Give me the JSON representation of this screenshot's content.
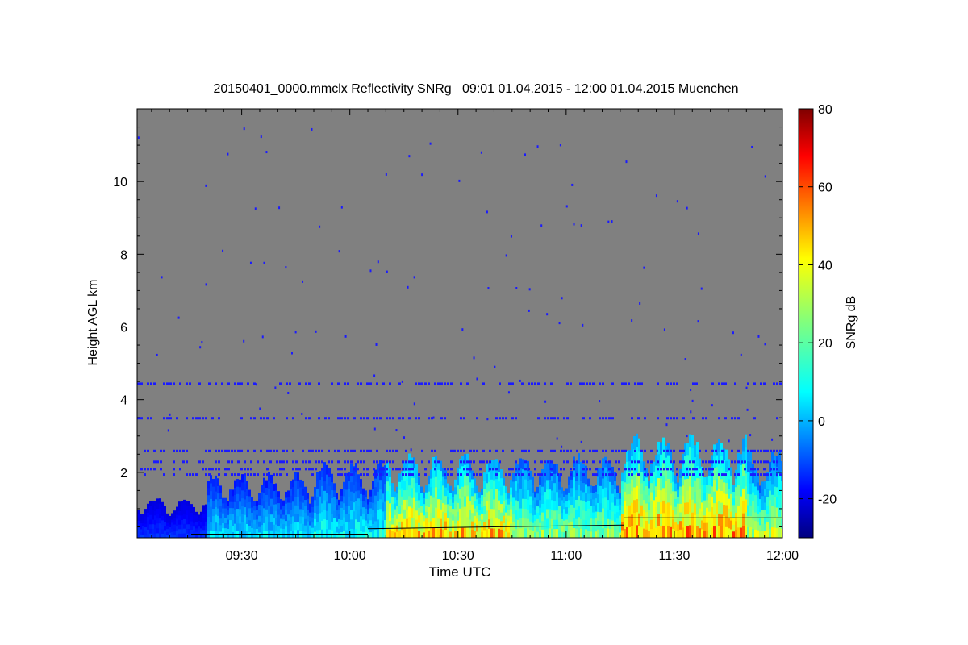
{
  "chart_data": {
    "type": "heatmap",
    "title": "20150401_0000.mmclx Reflectivity SNRg   09:01 01.04.2015 - 12:00 01.04.2015 Muenchen",
    "xlabel": "Time UTC",
    "ylabel": "Height AGL km",
    "x_ticks": [
      "09:30",
      "10:00",
      "10:30",
      "11:00",
      "11:30",
      "12:00"
    ],
    "x_range": [
      "09:01",
      "12:00"
    ],
    "y_ticks": [
      2,
      4,
      6,
      8,
      10
    ],
    "y_range": [
      0.2,
      12.0
    ],
    "background_color": "#808080",
    "colorbar": {
      "label": "SNRg dB",
      "range": [
        -30,
        80
      ],
      "ticks": [
        -20,
        0,
        20,
        40,
        60,
        80
      ],
      "colormap": "jet"
    },
    "clutter_layers_km": [
      4.45,
      3.5,
      2.6,
      2.3,
      2.1,
      1.95
    ],
    "echo_segments": [
      {
        "start": "09:01",
        "end": "09:20",
        "top_km": 1.2,
        "peak_snr_db": -10
      },
      {
        "start": "09:20",
        "end": "09:50",
        "top_km": 1.8,
        "peak_snr_db": 10
      },
      {
        "start": "09:50",
        "end": "10:10",
        "top_km": 2.1,
        "peak_snr_db": 15
      },
      {
        "start": "10:10",
        "end": "10:45",
        "top_km": 2.3,
        "peak_snr_db": 50
      },
      {
        "start": "10:45",
        "end": "11:15",
        "top_km": 2.3,
        "peak_snr_db": 30
      },
      {
        "start": "11:15",
        "end": "11:50",
        "top_km": 2.8,
        "peak_snr_db": 55
      },
      {
        "start": "11:50",
        "end": "12:00",
        "top_km": 2.4,
        "peak_snr_db": 35
      }
    ]
  }
}
